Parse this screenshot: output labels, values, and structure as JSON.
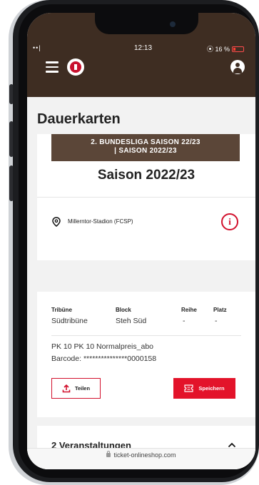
{
  "status": {
    "signal": "••|",
    "time": "12:13",
    "battery": "⦿ 16 %"
  },
  "colors": {
    "header": "#3e2d22",
    "banner": "#5b4638",
    "accent_red": "#e3132a"
  },
  "header": {
    "menu_icon": "hamburger-icon",
    "logo": "club-logo",
    "profile_icon": "user-icon"
  },
  "page": {
    "title": "Dauerkarten"
  },
  "event": {
    "banner_line1": "2. BUNDESLIGA SAISON 22/23",
    "banner_line2": "| SAISON 2022/23",
    "title": "Saison 2022/23",
    "venue": "Millerntor-Stadion (FCSP)",
    "info_label": "i"
  },
  "ticket": {
    "columns": [
      {
        "label": "Tribüne",
        "value": "Südtribüne"
      },
      {
        "label": "Block",
        "value": "Steh Süd"
      },
      {
        "label": "Reihe",
        "value": "-"
      },
      {
        "label": "Platz",
        "value": "-"
      }
    ],
    "product": "PK 10 PK 10 Normalpreis_abo",
    "barcode": "Barcode: ***************0000158",
    "share_label": "Teilen",
    "save_label": "Speichern"
  },
  "events_section": {
    "title": "2 Veranstaltungen"
  },
  "browser": {
    "url": "ticket-onlineshop.com"
  }
}
